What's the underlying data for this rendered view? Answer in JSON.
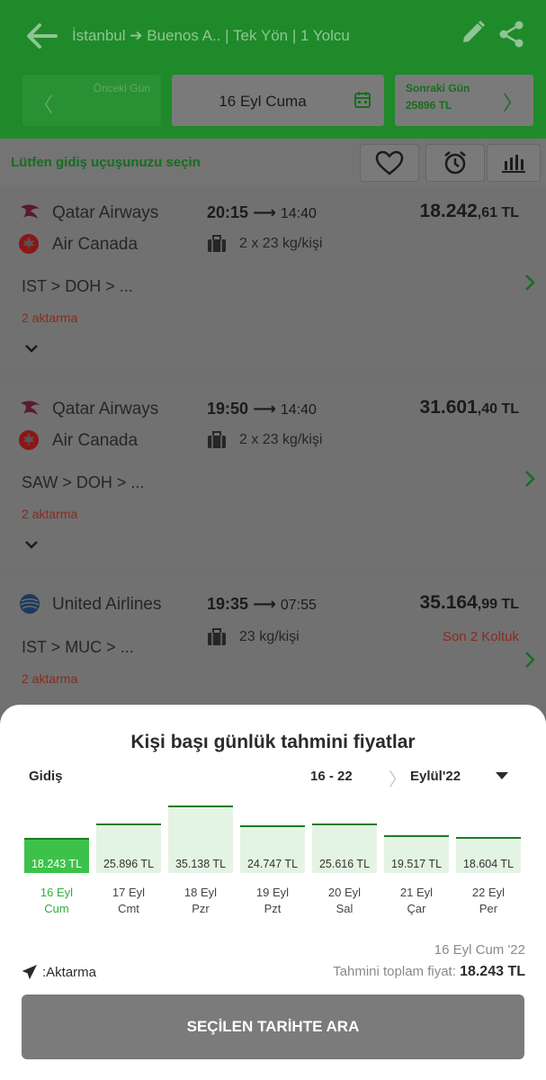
{
  "header": {
    "title": "İstanbul ➔ Buenos A.. | Tek Yön | 1 Yolcu",
    "prev_day_label": "Önceki Gün",
    "current_day": "16 Eyl Cuma",
    "next_day_label": "Sonraki Gün",
    "next_day_price": "25896 TL"
  },
  "subheader": {
    "instruction": "Lütfen gidiş uçuşunuzu seçin"
  },
  "flights": [
    {
      "airline1": "Qatar Airways",
      "airline2": "Air Canada",
      "dep": "20:15",
      "arr": "14:40",
      "price_main": "18.242",
      "price_cents": ",61 TL",
      "baggage": "2 x 23 kg/kişi",
      "route": "IST > DOH > ...",
      "stops": "2 aktarma"
    },
    {
      "airline1": "Qatar Airways",
      "airline2": "Air Canada",
      "dep": "19:50",
      "arr": "14:40",
      "price_main": "31.601",
      "price_cents": ",40 TL",
      "baggage": "2 x 23 kg/kişi",
      "route": "SAW > DOH > ...",
      "stops": "2 aktarma"
    },
    {
      "airline1": "United Airlines",
      "dep": "19:35",
      "arr": "07:55",
      "price_main": "35.164",
      "price_cents": ",99 TL",
      "baggage": "23 kg/kişi",
      "route": "IST > MUC > ...",
      "stops": "2 aktarma",
      "seats": "Son 2 Koltuk"
    }
  ],
  "sheet": {
    "title": "Kişi başı günlük tahmini fiyatlar",
    "direction": "Gidiş",
    "range": "16 - 22",
    "month": "Eylül'22",
    "selected_date": "16 Eyl Cum '22",
    "aktarma_label": ":Aktarma",
    "total_label": "Tahmini toplam fiyat:",
    "total_value": "18.243 TL",
    "search_button": "SEÇİLEN TARİHTE ARA"
  },
  "chart_data": {
    "type": "bar",
    "categories": [
      "16 Eyl Cum",
      "17 Eyl Cmt",
      "18 Eyl Pzr",
      "19 Eyl Pzt",
      "20 Eyl Sal",
      "21 Eyl Çar",
      "22 Eyl Per"
    ],
    "days": [
      {
        "d": "16 Eyl",
        "w": "Cum"
      },
      {
        "d": "17 Eyl",
        "w": "Cmt"
      },
      {
        "d": "18 Eyl",
        "w": "Pzr"
      },
      {
        "d": "19 Eyl",
        "w": "Pzt"
      },
      {
        "d": "20 Eyl",
        "w": "Sal"
      },
      {
        "d": "21 Eyl",
        "w": "Çar"
      },
      {
        "d": "22 Eyl",
        "w": "Per"
      }
    ],
    "values": [
      18243,
      25896,
      35138,
      24747,
      25616,
      19517,
      18604
    ],
    "value_labels": [
      "18.243 TL",
      "25.896 TL",
      "35.138 TL",
      "24.747 TL",
      "25.616 TL",
      "19.517 TL",
      "18.604 TL"
    ],
    "selected_index": 0,
    "colors": {
      "selected": "#3cc24a",
      "bar": "#e4f4e4",
      "border": "#1e7b27",
      "selected_text": "#2fae3b"
    }
  }
}
